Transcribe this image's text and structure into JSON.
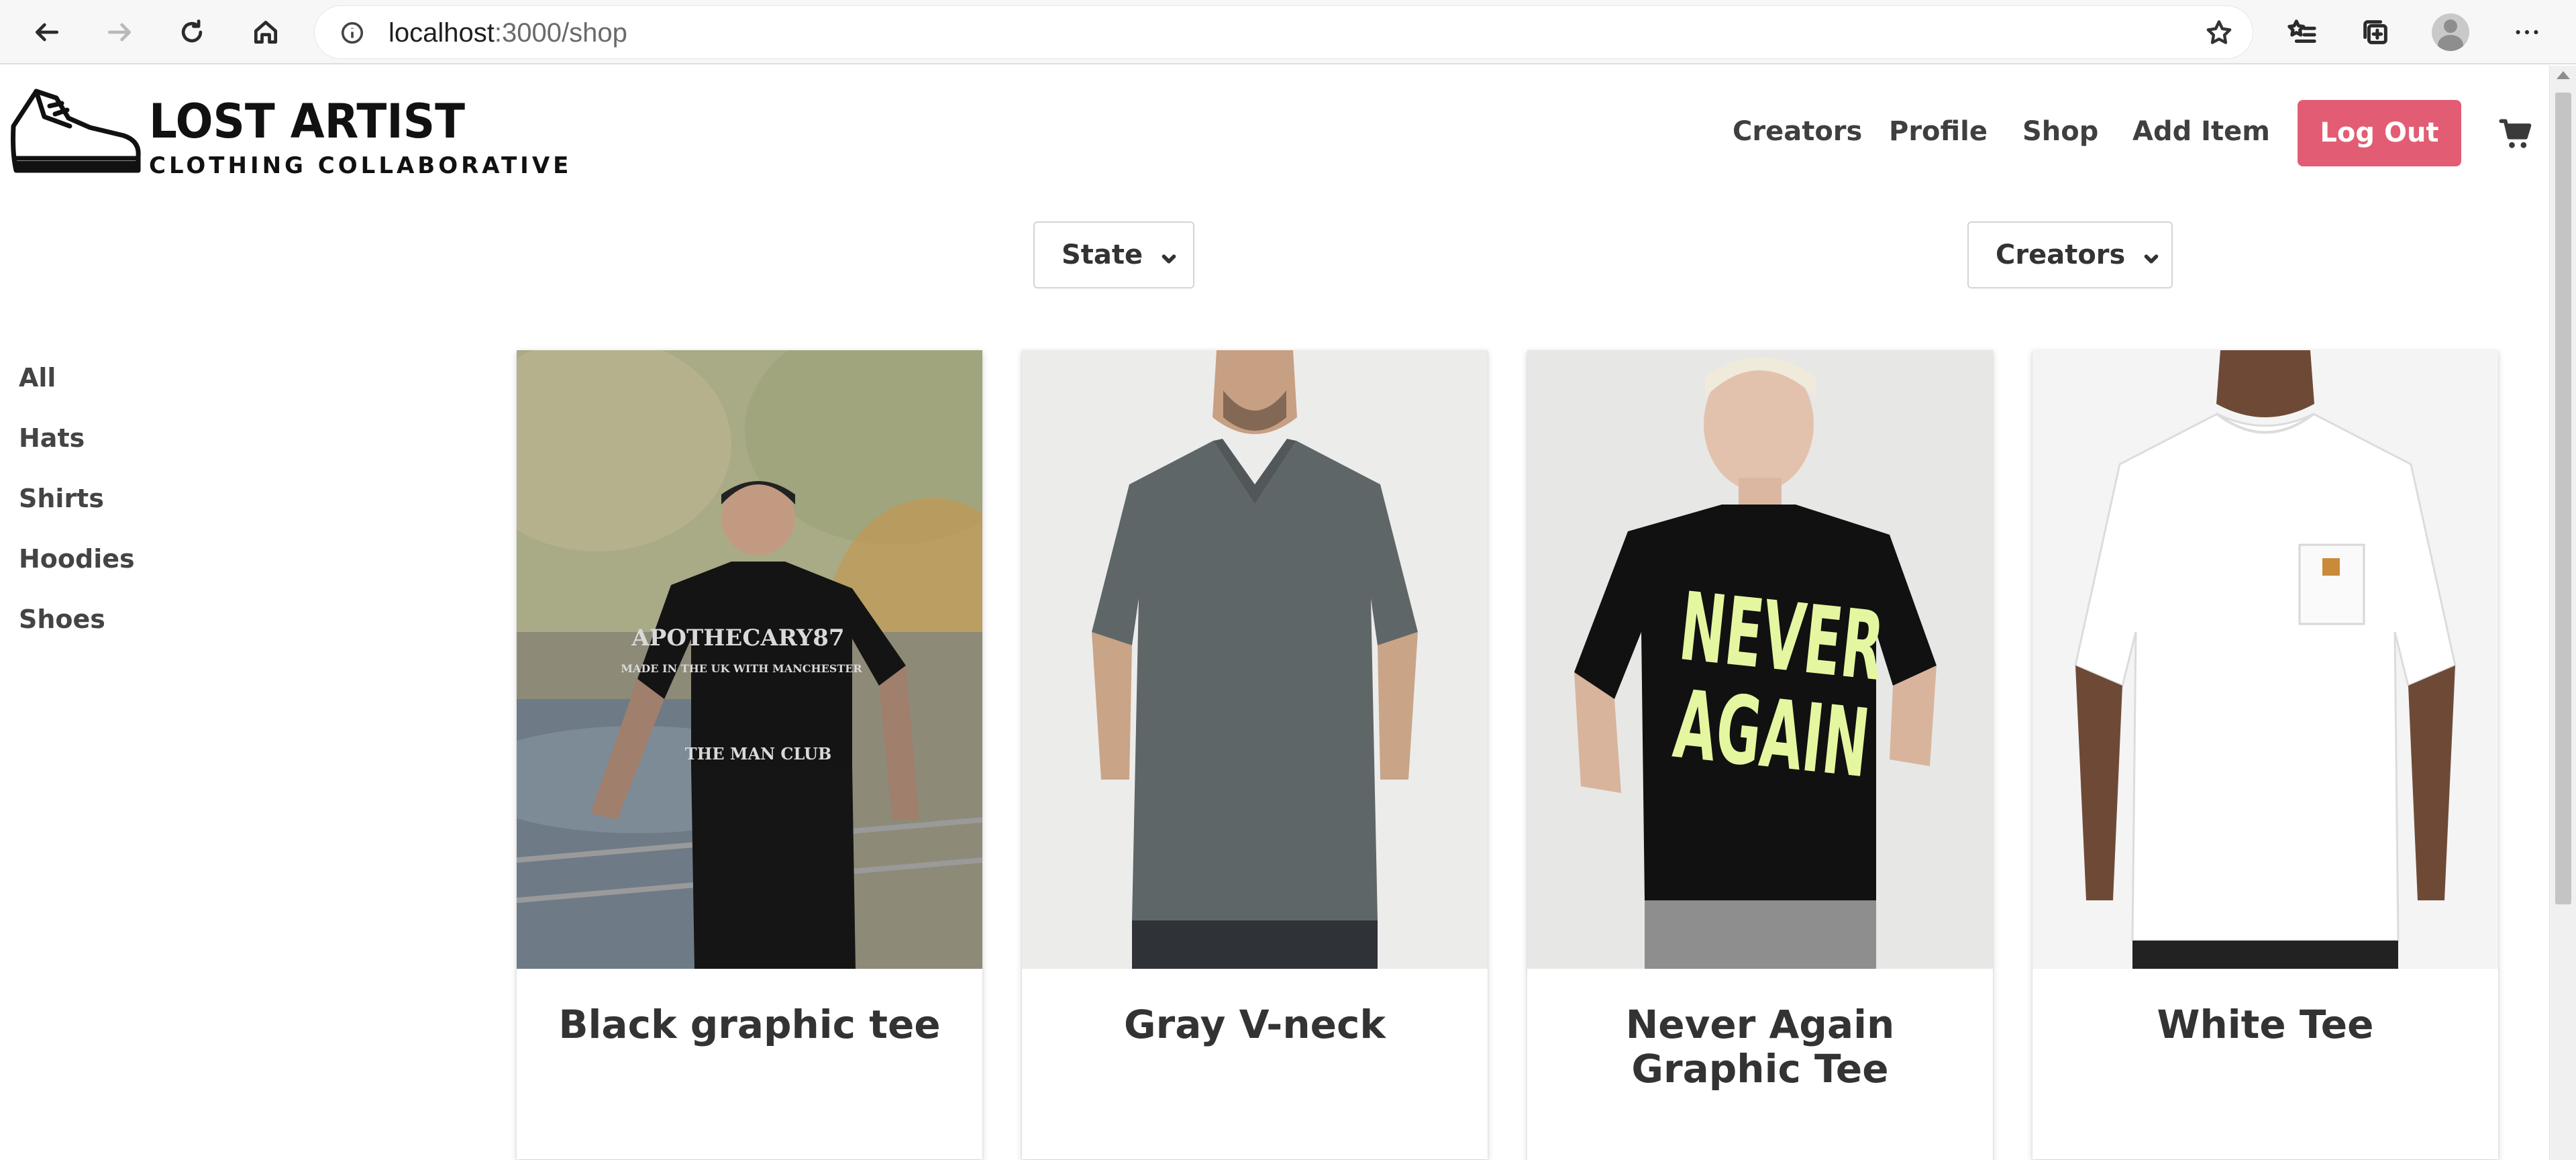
{
  "browser": {
    "url_host": "localhost",
    "url_path": ":3000/shop"
  },
  "brand": {
    "title": "LOST ARTIST",
    "subtitle": "CLOTHING COLLABORATIVE"
  },
  "nav": {
    "creators": "Creators",
    "profile": "Profile",
    "shop": "Shop",
    "add_item": "Add Item",
    "logout": "Log Out"
  },
  "filters": {
    "state_label": "State",
    "creators_label": "Creators"
  },
  "categories": [
    "All",
    "Hats",
    "Shirts",
    "Hoodies",
    "Shoes"
  ],
  "products": [
    {
      "title": "Black graphic tee",
      "shirt_color": "#141414"
    },
    {
      "title": "Gray V-neck",
      "shirt_color": "#5f6668"
    },
    {
      "title": "Never Again Graphic Tee",
      "shirt_color": "#111111",
      "print_text": "NEVER AGAIN",
      "print_color": "#e4f7a0"
    },
    {
      "title": "White Tee",
      "shirt_color": "#ffffff"
    }
  ],
  "colors": {
    "logout_bg": "#e25d73",
    "nav_text": "#3f3f3f"
  }
}
